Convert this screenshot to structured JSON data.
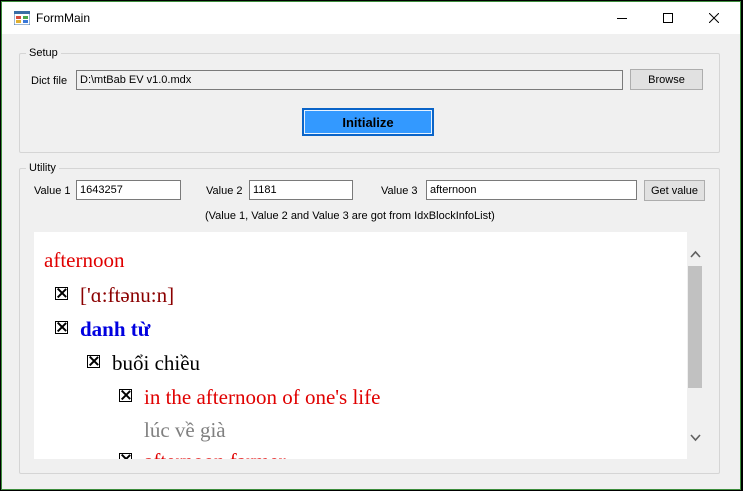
{
  "window": {
    "title": "FormMain"
  },
  "setup": {
    "legend": "Setup",
    "dict_label": "Dict file",
    "dict_value": "D:\\mtBab EV v1.0.mdx",
    "browse_label": "Browse",
    "init_label": "Initialize"
  },
  "utility": {
    "legend": "Utility",
    "value1_label": "Value 1",
    "value1": "1643257",
    "value2_label": "Value 2",
    "value2": "1181",
    "value3_label": "Value 3",
    "value3": "afternoon",
    "get_label": "Get value",
    "note": "(Value 1, Value 2 and Value 3 are got from IdxBlockInfoList)"
  },
  "entry": {
    "headword": "afternoon",
    "pronunciation": "['ɑ:ftənu:n]",
    "pos": "danh từ",
    "sense": "buổi chiều",
    "phrase": "in the afternoon of one's life",
    "phrase_meaning": "lúc về già",
    "next_phrase": "afternoon farmer"
  },
  "colors": {
    "red": "#e00000",
    "dark_red": "#8b0000",
    "blue": "#0000e0",
    "gray": "#808080",
    "accent_button": "#3399ff"
  }
}
